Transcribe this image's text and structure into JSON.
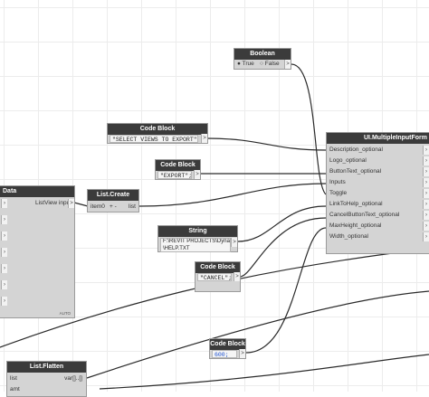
{
  "boolean_node": {
    "title": "Boolean",
    "true_label": "True",
    "false_label": "False",
    "selected": "True"
  },
  "code_block_views": {
    "title": "Code Block",
    "code": "\"SELECT VIEWS TO EXPORT\";"
  },
  "code_block_export": {
    "title": "Code Block",
    "code": "\"EXPORT\";"
  },
  "data_node": {
    "title": "Data",
    "port_label": "ListView input",
    "footer": "AUTO"
  },
  "list_create": {
    "title": "List.Create",
    "input_label": "item0",
    "output_label": "list"
  },
  "string_node": {
    "title": "String",
    "value_line1": "F:\\REVIT PROJECTS\\Dynamo",
    "value_line2": "\\HELP.TXT"
  },
  "code_block_cancel": {
    "title": "Code Block",
    "code": "\"CANCEL\";"
  },
  "code_block_600": {
    "title": "Code Block",
    "code": "600;"
  },
  "list_flatten": {
    "title": "List.Flatten",
    "inputs": [
      "list",
      "amt"
    ],
    "output_label": "var[]..[]"
  },
  "ui_form": {
    "title": "UI.MultipleInputForm",
    "ports": [
      "Description_optional",
      "Logo_optional",
      "ButtonText_optional",
      "Inputs",
      "Toggle",
      "LinkToHelp_optional",
      "CancelButtonText_optional",
      "MaxHeight_optional",
      "Width_optional"
    ]
  },
  "colors": {
    "header": "#3b3b3b",
    "node_body": "#d4d4d4",
    "wire": "#2a2a2a",
    "number": "#1a4fd0"
  }
}
